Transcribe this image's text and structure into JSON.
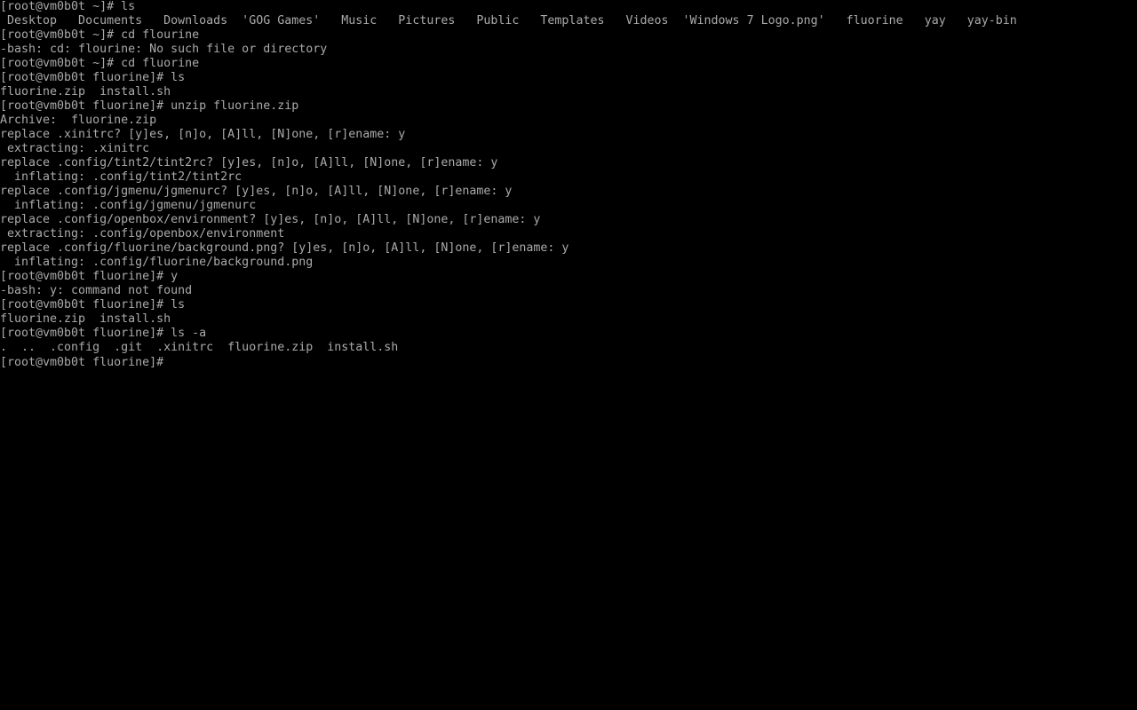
{
  "terminal": {
    "foreground": "#aaaaaa",
    "background": "#000000",
    "lines": [
      "[root@vm0b0t ~]# ls",
      " Desktop   Documents   Downloads  'GOG Games'   Music   Pictures   Public   Templates   Videos  'Windows 7 Logo.png'   fluorine   yay   yay-bin",
      "[root@vm0b0t ~]# cd flourine",
      "-bash: cd: flourine: No such file or directory",
      "[root@vm0b0t ~]# cd fluorine",
      "[root@vm0b0t fluorine]# ls",
      "fluorine.zip  install.sh",
      "[root@vm0b0t fluorine]# unzip fluorine.zip",
      "Archive:  fluorine.zip",
      "replace .xinitrc? [y]es, [n]o, [A]ll, [N]one, [r]ename: y",
      " extracting: .xinitrc",
      "replace .config/tint2/tint2rc? [y]es, [n]o, [A]ll, [N]one, [r]ename: y",
      "  inflating: .config/tint2/tint2rc",
      "replace .config/jgmenu/jgmenurc? [y]es, [n]o, [A]ll, [N]one, [r]ename: y",
      "  inflating: .config/jgmenu/jgmenurc",
      "replace .config/openbox/environment? [y]es, [n]o, [A]ll, [N]one, [r]ename: y",
      " extracting: .config/openbox/environment",
      "replace .config/fluorine/background.png? [y]es, [n]o, [A]ll, [N]one, [r]ename: y",
      "  inflating: .config/fluorine/background.png",
      "[root@vm0b0t fluorine]# y",
      "-bash: y: command not found",
      "[root@vm0b0t fluorine]# ls",
      "fluorine.zip  install.sh",
      "[root@vm0b0t fluorine]# ls -a",
      ".  ..  .config  .git  .xinitrc  fluorine.zip  install.sh"
    ],
    "prompt": "[root@vm0b0t fluorine]# "
  }
}
